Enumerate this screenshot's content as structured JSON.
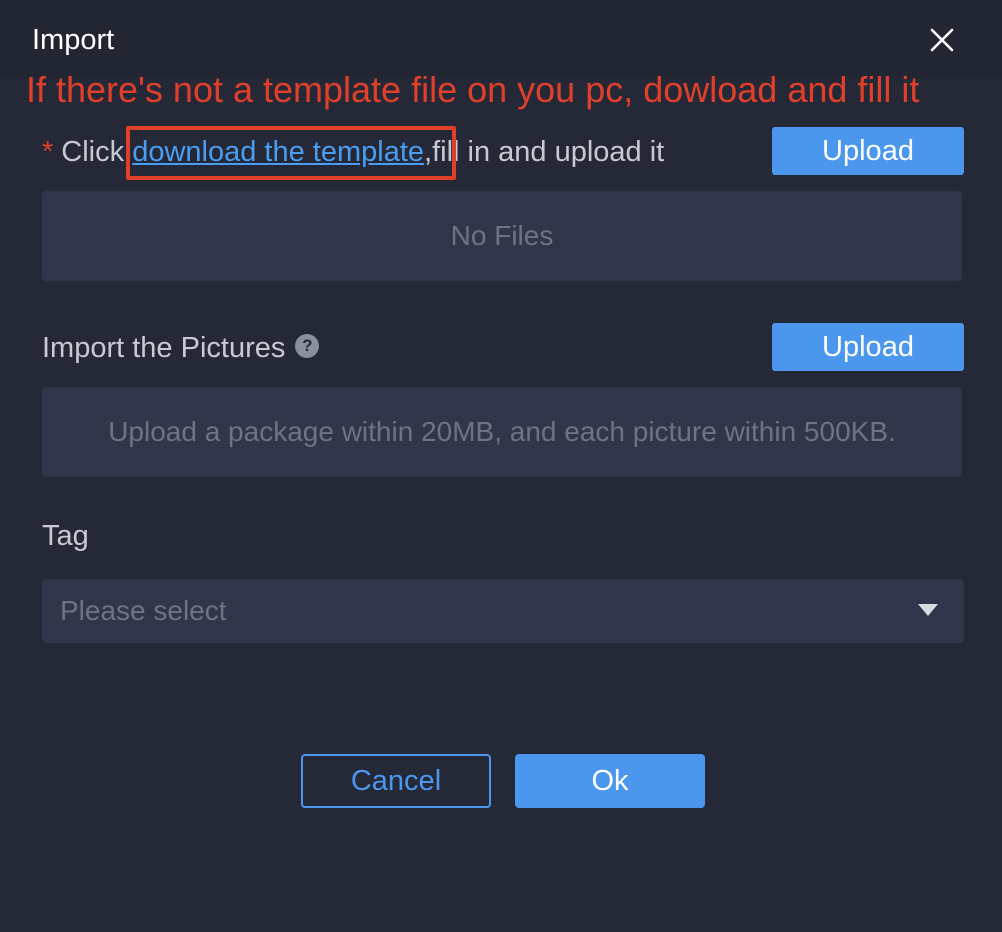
{
  "dialog": {
    "title": "Import",
    "close_icon": "close-icon"
  },
  "annotation": {
    "text": "If there's not a template file on you pc, dowload and fill it",
    "color": "#e0402a"
  },
  "template_row": {
    "required_mark": "*",
    "prefix": "Click",
    "link_text": "download the template",
    "suffix": ",fill in and upload it",
    "upload_label": "Upload",
    "empty_text": "No Files"
  },
  "pictures_row": {
    "label": "Import the Pictures",
    "help_icon": "question-circle-icon",
    "help_glyph": "?",
    "upload_label": "Upload",
    "hint_text": "Upload a package within 20MB, and each picture within 500KB."
  },
  "tag_row": {
    "label": "Tag",
    "placeholder": "Please select"
  },
  "footer": {
    "cancel_label": "Cancel",
    "ok_label": "Ok"
  },
  "colors": {
    "accent": "#4a97ed",
    "background": "#242837",
    "field_background": "#31364a",
    "annotation_red": "#e0402a"
  }
}
